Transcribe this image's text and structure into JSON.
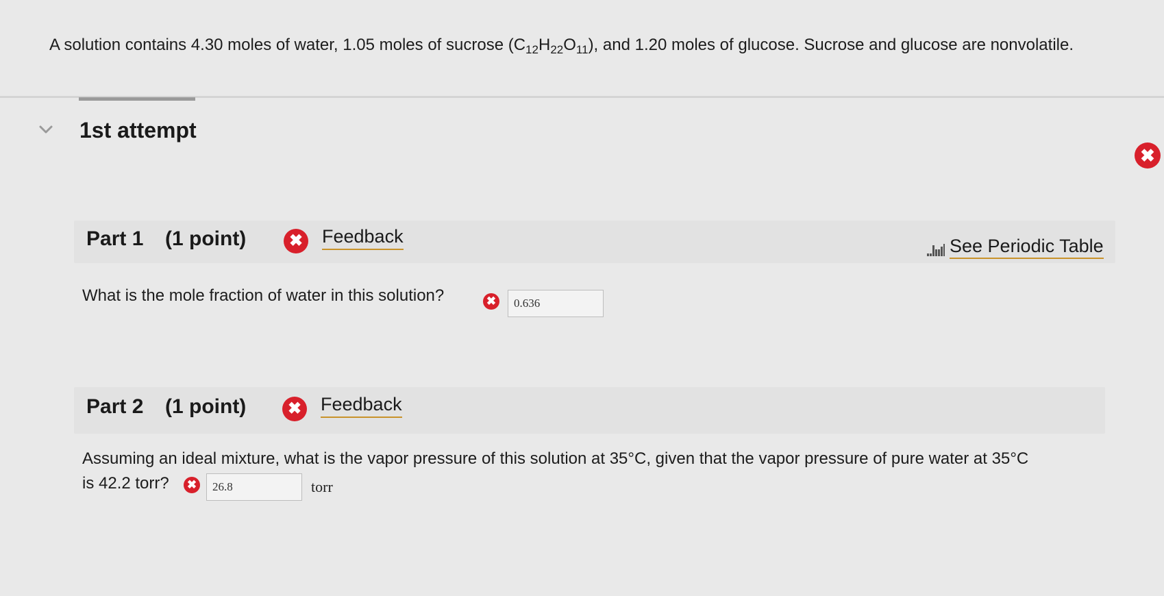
{
  "problem": {
    "text_before_formula": "A solution contains 4.30 moles of water, 1.05 moles of sucrose (",
    "formula": [
      "C",
      "12",
      "H",
      "22",
      "O",
      "11"
    ],
    "text_after_formula": "), and 1.20 moles of glucose. Sucrose and glucose are nonvolatile."
  },
  "attempt": {
    "title": "1st attempt",
    "status_icon": "x-circle-icon",
    "status_color": "#d8202b"
  },
  "parts": [
    {
      "label": "Part 1",
      "points": "(1 point)",
      "feedback_label": "Feedback",
      "status_icon": "x-circle-icon",
      "question": "What is the mole fraction of water in this solution?",
      "answer": "0.636",
      "unit": ""
    },
    {
      "label": "Part 2",
      "points": "(1 point)",
      "feedback_label": "Feedback",
      "status_icon": "x-circle-icon",
      "question_line1": "Assuming an ideal mixture, what is the vapor pressure of this solution at 35°C, given that the vapor pressure of pure water at 35°C",
      "question_line2": "is 42.2 torr?",
      "answer": "26.8",
      "unit": "torr"
    }
  ],
  "periodic_table": {
    "label": "See Periodic Table",
    "icon": "periodic-table-icon"
  },
  "colors": {
    "error": "#d8202b",
    "link_underline": "#c8922a",
    "background": "#e9e9e9"
  }
}
